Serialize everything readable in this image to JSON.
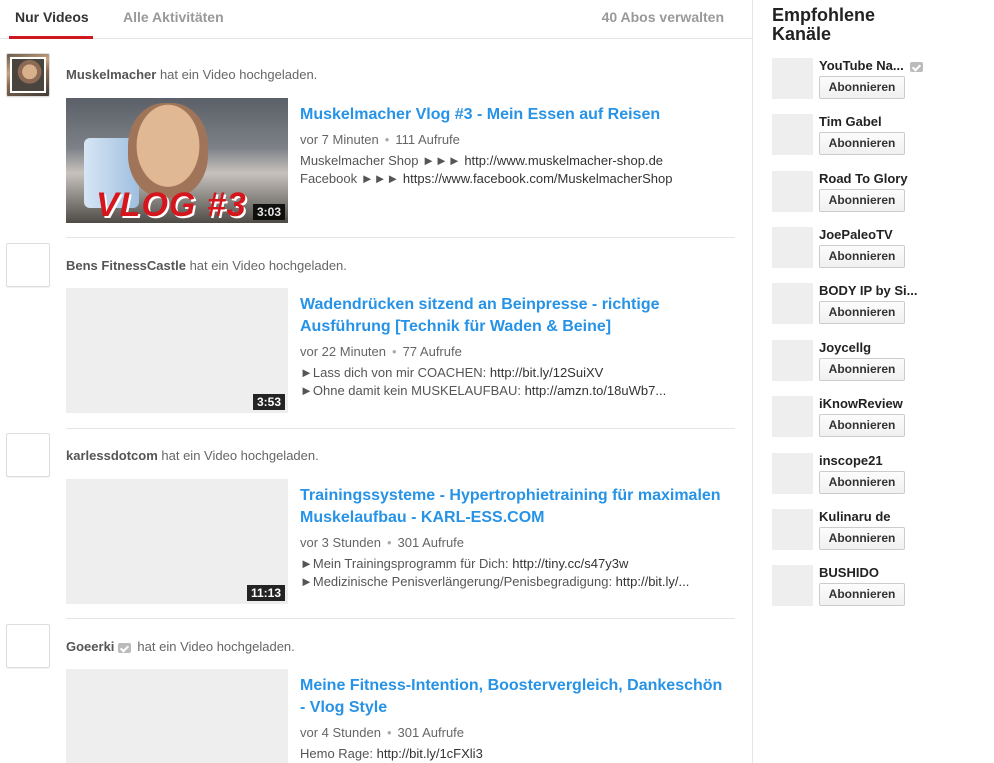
{
  "tabs": {
    "active": "Nur Videos",
    "inactive": "Alle Aktivitäten",
    "manage": "40 Abos verwalten"
  },
  "feed": [
    {
      "channel": "Muskelmacher",
      "action": "hat ein Video hochgeladen.",
      "title": "Muskelmacher Vlog #3 - Mein Essen auf Reisen",
      "time": "vor 7 Minuten",
      "views": "111 Aufrufe",
      "duration": "3:03",
      "thumb_text": "VLOG #3",
      "desc": [
        {
          "text": "Muskelmacher Shop ►►► ",
          "link": "http://www.muskelmacher-shop.de"
        },
        {
          "text": "Facebook ►►► ",
          "link": "https://www.facebook.com/MuskelmacherShop"
        }
      ]
    },
    {
      "channel": "Bens FitnessCastle",
      "action": "hat ein Video hochgeladen.",
      "title": "Wadendrücken sitzend an Beinpresse - richtige Ausführung [Technik für Waden & Beine]",
      "time": "vor 22 Minuten",
      "views": "77 Aufrufe",
      "duration": "3:53",
      "desc": [
        {
          "text": "►Lass dich von mir COACHEN: ",
          "link": "http://bit.ly/12SuiXV"
        },
        {
          "text": "►Ohne damit kein MUSKELAUFBAU: ",
          "link": "http://amzn.to/18uWb7..."
        }
      ]
    },
    {
      "channel": "karlessdotcom",
      "action": "hat ein Video hochgeladen.",
      "title": "Trainingssysteme - Hypertrophietraining für maximalen Muskelaufbau - KARL-ESS.COM",
      "time": "vor 3 Stunden",
      "views": "301 Aufrufe",
      "duration": "11:13",
      "desc": [
        {
          "text": "►Mein Trainingsprogramm für Dich: ",
          "link": "http://tiny.cc/s47y3w"
        },
        {
          "text": "►Medizinische Penisverlängerung/Penisbegradigung: ",
          "link": "http://bit.ly/..."
        }
      ]
    },
    {
      "channel": "Goeerki",
      "action": "hat ein Video hochgeladen.",
      "title": "Meine Fitness-Intention, Boostervergleich, Dankeschön - Vlog Style",
      "time": "vor 4 Stunden",
      "views": "301 Aufrufe",
      "duration": "",
      "desc": [
        {
          "text": "Hemo Rage: ",
          "link": "http://bit.ly/1cFXli3"
        }
      ]
    }
  ],
  "sidebar": {
    "title": "Empfohlene Kanäle",
    "subscribe_label": "Abonnieren",
    "channels": [
      "YouTube Na...",
      "Tim Gabel",
      "Road To Glory",
      "JoePaleoTV",
      "BODY IP by Si...",
      "Joycellg",
      "iKnowReview",
      "inscope21",
      "Kulinaru de",
      "BUSHIDO"
    ]
  },
  "colors": {
    "accent_red": "#cc181e",
    "title_blue": "#2793e6"
  }
}
